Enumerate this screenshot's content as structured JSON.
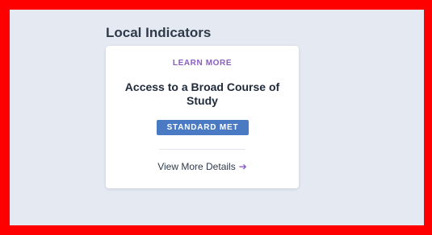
{
  "section": {
    "title": "Local Indicators"
  },
  "card": {
    "learn_more_label": "LEARN MORE",
    "indicator_name": "Access to a Broad Course of Study",
    "status_badge": "STANDARD MET",
    "view_more_label": "View More Details",
    "arrow_icon": "arrow-right-icon"
  },
  "colors": {
    "frame_border": "#ff0000",
    "background": "#e5eaf2",
    "accent_purple": "#8a5cc2",
    "badge_blue": "#4a7ac4"
  }
}
